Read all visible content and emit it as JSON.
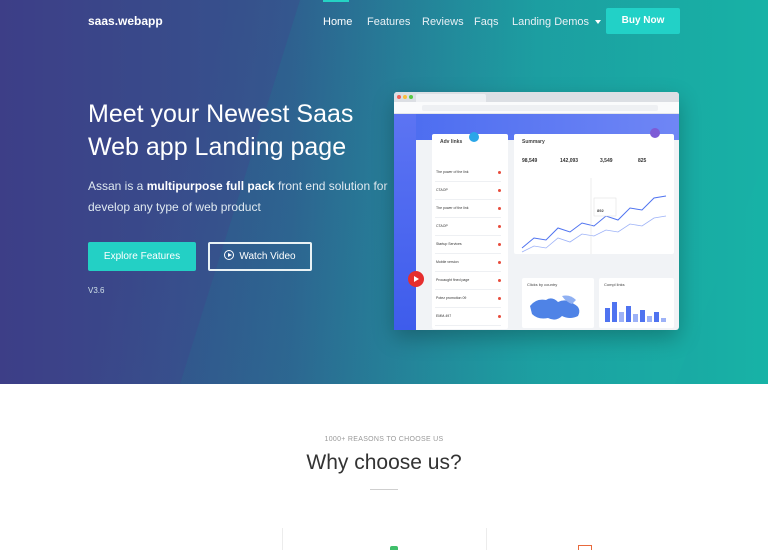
{
  "nav": {
    "brand": "saas.webapp",
    "items": [
      "Home",
      "Features",
      "Reviews",
      "Faqs",
      "Landing Demos"
    ],
    "buy": "Buy Now"
  },
  "hero": {
    "title_line1": "Meet your Newest Saas",
    "title_line2": "Web app Landing page",
    "sub_pre": "Assan is a ",
    "sub_bold": "multipurpose full pack",
    "sub_post": " front end solution for develop any type of web product",
    "explore": "Explore Features",
    "watch": "Watch Video",
    "version": "V3.6"
  },
  "mock": {
    "list_title": "Adv links",
    "summary_title": "Summary",
    "stats": [
      "98,549",
      "142,093",
      "3,549",
      "825"
    ],
    "list_items": [
      "The power of the link",
      "CTAOP",
      "The power of the link",
      "CTAOP",
      "Startup Services",
      "Mobile version",
      "Procaught fined page",
      "Potez promotion 09",
      "EMM-497"
    ],
    "card1_title": "Clicks by country",
    "card2_title": "Compl links",
    "chart_value": "892"
  },
  "lower": {
    "kicker": "1000+ REASONS TO CHOOSE US",
    "title": "Why choose us?"
  },
  "colors": {
    "accent": "#22d1c7",
    "gradient_start": "#3a3f86",
    "gradient_end": "#17b3a6"
  }
}
